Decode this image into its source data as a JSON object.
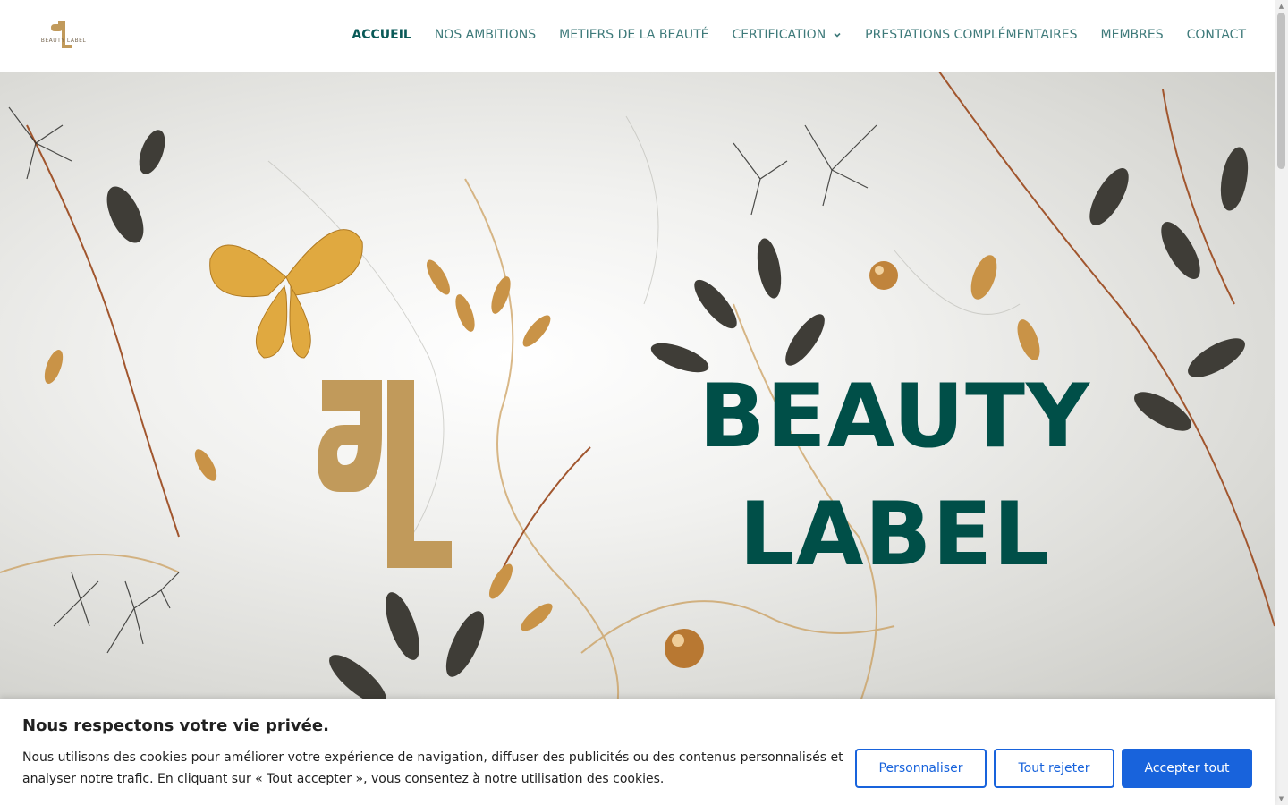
{
  "header": {
    "logo_text": "BEAUTY LABEL",
    "nav": [
      {
        "label": "ACCUEIL",
        "active": true
      },
      {
        "label": "NOS AMBITIONS"
      },
      {
        "label": "METIERS DE LA BEAUTÉ"
      },
      {
        "label": "CERTIFICATION",
        "has_dropdown": true
      },
      {
        "label": "PRESTATIONS COMPLÉMENTAIRES"
      },
      {
        "label": "MEMBRES"
      },
      {
        "label": "CONTACT"
      }
    ]
  },
  "hero": {
    "title_line1": "BEAUTY",
    "title_line2": "LABEL"
  },
  "cookie": {
    "title": "Nous respectons votre vie privée.",
    "text": "Nous utilisons des cookies pour améliorer votre expérience de navigation, diffuser des publicités ou des contenus personnalisés et analyser notre trafic. En cliquant sur « Tout accepter », vous consentez à notre utilisation des cookies.",
    "customize_label": "Personnaliser",
    "reject_label": "Tout rejeter",
    "accept_label": "Accepter tout"
  },
  "colors": {
    "brand_green": "#004f48",
    "nav_teal": "#3e7a7a",
    "gold": "#c19a5b",
    "cookie_blue": "#1863dc"
  }
}
